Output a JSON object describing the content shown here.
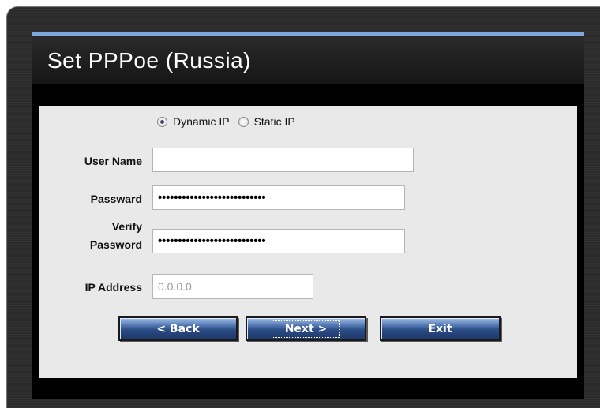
{
  "window": {
    "title": "Set PPPoe (Russia)"
  },
  "connection_type": {
    "options": [
      "Dynamic IP",
      "Static IP"
    ],
    "selected": "Dynamic IP"
  },
  "form": {
    "username_label": "User Name",
    "username_value": "",
    "password_label": "Passward",
    "password_value": "•••••••••••••••••••••••••••",
    "verify_label_line1": "Verify",
    "verify_label_line2": "Password",
    "verify_value": "•••••••••••••••••••••••••••",
    "ip_label": "IP Address",
    "ip_placeholder": "0.0.0.0"
  },
  "buttons": {
    "back": "< Back",
    "next": "Next >",
    "exit": "Exit"
  },
  "colors": {
    "title_accent": "#7ea8dd",
    "content_bg": "#e9e9e9",
    "button_blue": "#2c4d86"
  }
}
